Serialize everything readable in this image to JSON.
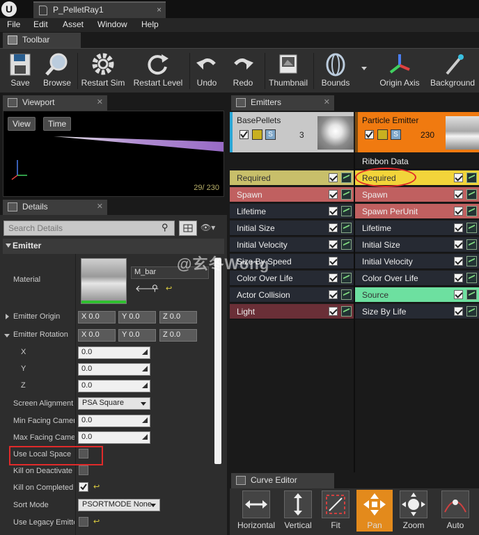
{
  "tab": {
    "title": "P_PelletRay1",
    "close": "×"
  },
  "menu": [
    "File",
    "Edit",
    "Asset",
    "Window",
    "Help"
  ],
  "toolbar_panel": {
    "title": "Toolbar"
  },
  "toolbar": [
    {
      "label": "Save",
      "icon": "save-icon"
    },
    {
      "label": "Browse",
      "icon": "browse-icon"
    },
    {
      "label": "Restart Sim",
      "icon": "gear-icon"
    },
    {
      "label": "Restart Level",
      "icon": "refresh-icon"
    },
    {
      "label": "Undo",
      "icon": "undo-icon"
    },
    {
      "label": "Redo",
      "icon": "redo-icon"
    },
    {
      "label": "Thumbnail",
      "icon": "thumbnail-icon"
    },
    {
      "label": "Bounds",
      "icon": "bounds-icon"
    },
    {
      "label": "Origin Axis",
      "icon": "axis-icon"
    },
    {
      "label": "Background",
      "icon": "background-icon"
    }
  ],
  "viewport": {
    "title": "Viewport",
    "view_btn": "View",
    "time_btn": "Time",
    "counter": "29/ 230"
  },
  "details": {
    "title": "Details",
    "search_placeholder": "Search Details",
    "section": "Emitter",
    "material_label": "Material",
    "material_value": "M_bar",
    "emitter_origin": "Emitter Origin",
    "emitter_rotation": "Emitter Rotation",
    "x_label": "X",
    "y_label": "Y",
    "z_label": "Z",
    "xyz_zero": "0.0",
    "vec_x": "X  0.0",
    "vec_y": "Y  0.0",
    "vec_z": "Z  0.0",
    "screen_alignment": "Screen Alignment",
    "screen_alignment_value": "PSA Square",
    "min_facing": "Min Facing Camera Blend Distance",
    "min_facing_value": "0.0",
    "max_facing": "Max Facing Camera Blend Distance",
    "max_facing_value": "0.0",
    "use_local_space": "Use Local Space",
    "kill_on_deactivate": "Kill on Deactivate",
    "kill_on_completed": "Kill on Completed",
    "sort_mode": "Sort Mode",
    "sort_mode_value": "PSORTMODE None",
    "use_legacy": "Use Legacy Emitter Time"
  },
  "emitters": {
    "title": "Emitters",
    "col1": {
      "name": "BasePellets",
      "count": "3",
      "modules": [
        {
          "label": "Required",
          "color": "#c8bf6a",
          "curve": true
        },
        {
          "label": "Spawn",
          "color": "#c06060",
          "curve": true
        },
        {
          "label": "Lifetime",
          "color": "#262a33",
          "curve": true
        },
        {
          "label": "Initial Size",
          "color": "#262a33",
          "curve": true
        },
        {
          "label": "Initial Velocity",
          "color": "#262a33",
          "curve": true
        },
        {
          "label": "Size By Speed",
          "color": "#262a33",
          "curve": false
        },
        {
          "label": "Color Over Life",
          "color": "#262a33",
          "curve": true
        },
        {
          "label": "Actor Collision",
          "color": "#262a33",
          "curve": true
        },
        {
          "label": "Light",
          "color": "#6a2f37",
          "curve": true
        }
      ]
    },
    "col2": {
      "name": "Particle Emitter",
      "count": "230",
      "type_data": "Ribbon Data",
      "modules": [
        {
          "label": "Required",
          "color": "#f2d43a",
          "curve": true
        },
        {
          "label": "Spawn",
          "color": "#c06060",
          "curve": true
        },
        {
          "label": "Spawn PerUnit",
          "color": "#c06060",
          "curve": true
        },
        {
          "label": "Lifetime",
          "color": "#262a33",
          "curve": true
        },
        {
          "label": "Initial Size",
          "color": "#262a33",
          "curve": true
        },
        {
          "label": "Initial Velocity",
          "color": "#262a33",
          "curve": true
        },
        {
          "label": "Color Over Life",
          "color": "#262a33",
          "curve": true
        },
        {
          "label": "Source",
          "color": "#6de0a0",
          "curve": true
        },
        {
          "label": "Size By Life",
          "color": "#262a33",
          "curve": true
        }
      ]
    }
  },
  "curve_editor": {
    "title": "Curve Editor",
    "buttons": [
      {
        "label": "Horizontal",
        "icon": "horizontal-icon"
      },
      {
        "label": "Vertical",
        "icon": "vertical-icon"
      },
      {
        "label": "Fit",
        "icon": "fit-icon"
      },
      {
        "label": "Pan",
        "icon": "pan-icon"
      },
      {
        "label": "Zoom",
        "icon": "zoom-icon"
      },
      {
        "label": "Auto",
        "icon": "auto-icon"
      }
    ]
  },
  "watermark": "@玄冬Wong",
  "colors": {
    "accent_orange": "#f07a10",
    "highlight_red": "#e02a2a",
    "selected_required": "#f2d43a"
  }
}
